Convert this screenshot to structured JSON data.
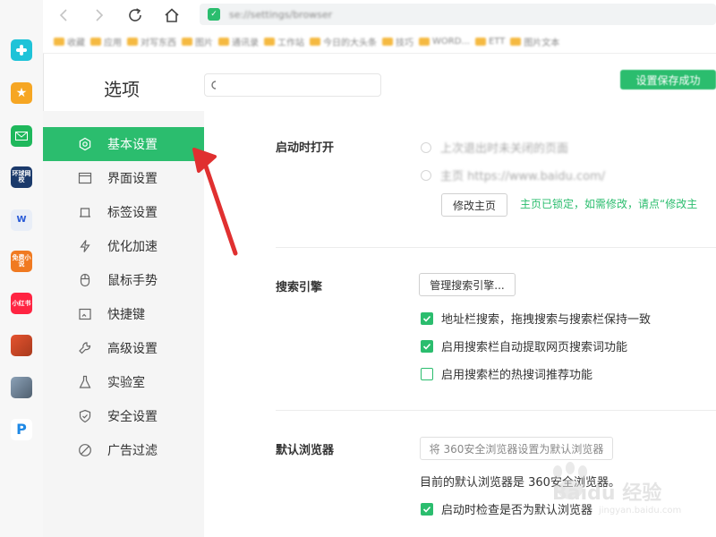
{
  "browser": {
    "url": "se://settings/browser",
    "bookmarks": [
      "收藏",
      "应用",
      "对写东西",
      "图片",
      "通讯录",
      "工作站",
      "今日的大头条",
      "技巧",
      "WORD...",
      "ETT",
      "图片文本"
    ]
  },
  "dock": [
    {
      "name": "plus-app-icon",
      "color": "#1fc3d8",
      "label": ""
    },
    {
      "name": "favorites-app-icon",
      "color": "#f6a623",
      "label": "★"
    },
    {
      "name": "mail-app-icon",
      "color": "#1fb85c",
      "label": ""
    },
    {
      "name": "news-app-icon",
      "color": "#1b3a6b",
      "label": "环球网校"
    },
    {
      "name": "word-app-icon",
      "color": "#e9eef7",
      "label": "W"
    },
    {
      "name": "novel-app-icon",
      "color": "#f07a21",
      "label": "免费小说"
    },
    {
      "name": "xiaohongshu-app-icon",
      "color": "#ff2442",
      "label": "小红书"
    },
    {
      "name": "game-app-icon",
      "color": "#c74a2a",
      "label": ""
    },
    {
      "name": "game2-app-icon",
      "color": "#6b7d8f",
      "label": ""
    },
    {
      "name": "p-app-icon",
      "color": "#ffffff",
      "label": "P"
    }
  ],
  "header": {
    "title": "选项",
    "search_placeholder": "",
    "toast": "设置保存成功"
  },
  "sidebar": {
    "items": [
      {
        "label": "基本设置",
        "icon": "gear-icon",
        "active": true
      },
      {
        "label": "界面设置",
        "icon": "window-icon",
        "active": false
      },
      {
        "label": "标签设置",
        "icon": "tab-icon",
        "active": false
      },
      {
        "label": "优化加速",
        "icon": "lightning-icon",
        "active": false
      },
      {
        "label": "鼠标手势",
        "icon": "mouse-icon",
        "active": false
      },
      {
        "label": "快捷键",
        "icon": "keyboard-icon",
        "active": false
      },
      {
        "label": "高级设置",
        "icon": "wrench-icon",
        "active": false
      },
      {
        "label": "实验室",
        "icon": "flask-icon",
        "active": false
      },
      {
        "label": "安全设置",
        "icon": "shield-icon",
        "active": false
      },
      {
        "label": "广告过滤",
        "icon": "block-icon",
        "active": false
      }
    ]
  },
  "startup": {
    "label": "启动时打开",
    "option1": "上次退出时未关闭的页面",
    "option2": "主页 https://www.baidu.com/",
    "modify_home_button": "修改主页",
    "locked_note": "主页已锁定，如需修改，请点“修改主"
  },
  "search_engine": {
    "label": "搜索引擎",
    "manage_button": "管理搜索引擎...",
    "options": [
      {
        "label": "地址栏搜索，拖拽搜索与搜索栏保持一致",
        "checked": true
      },
      {
        "label": "启用搜索栏自动提取网页搜索词功能",
        "checked": true
      },
      {
        "label": "启用搜索栏的热搜词推荐功能",
        "checked": false
      }
    ]
  },
  "default_browser": {
    "label": "默认浏览器",
    "set_default_button": "将 360安全浏览器设置为默认浏览器",
    "status": "目前的默认浏览器是 360安全浏览器。",
    "check_on_start": "启动时检查是否为默认浏览器",
    "check_on_start_checked": true
  },
  "watermark": {
    "text": "Baidu 经验",
    "sub": "jingyan.baidu.com"
  },
  "colors": {
    "accent": "#2bbd6e",
    "annotation": "#e03030"
  }
}
